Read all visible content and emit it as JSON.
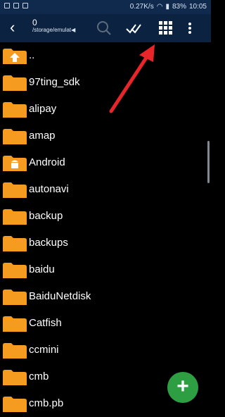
{
  "status_bar": {
    "speed": "0.27K/s",
    "battery": "83%",
    "time": "10:05"
  },
  "toolbar": {
    "title": "0",
    "path": "/storage/emulat◀"
  },
  "icons": {
    "back": "back-arrow-icon",
    "search": "search-icon",
    "select": "check-icon",
    "grid": "grid-view-icon",
    "menu": "more-vertical-icon",
    "fab": "plus-icon"
  },
  "files": [
    {
      "name": "..",
      "type": "up"
    },
    {
      "name": "97ting_sdk",
      "type": "folder"
    },
    {
      "name": "alipay",
      "type": "folder"
    },
    {
      "name": "amap",
      "type": "folder"
    },
    {
      "name": "Android",
      "type": "android"
    },
    {
      "name": "autonavi",
      "type": "folder"
    },
    {
      "name": "backup",
      "type": "folder"
    },
    {
      "name": "backups",
      "type": "folder"
    },
    {
      "name": "baidu",
      "type": "folder"
    },
    {
      "name": "BaiduNetdisk",
      "type": "folder"
    },
    {
      "name": "Catfish",
      "type": "folder"
    },
    {
      "name": "ccmini",
      "type": "folder"
    },
    {
      "name": "cmb",
      "type": "folder"
    },
    {
      "name": "cmb.pb",
      "type": "folder"
    }
  ],
  "colors": {
    "folder": "#f59b1f",
    "toolbar": "#0b2240",
    "fab": "#2e9e43",
    "annotation": "#e8262a"
  }
}
